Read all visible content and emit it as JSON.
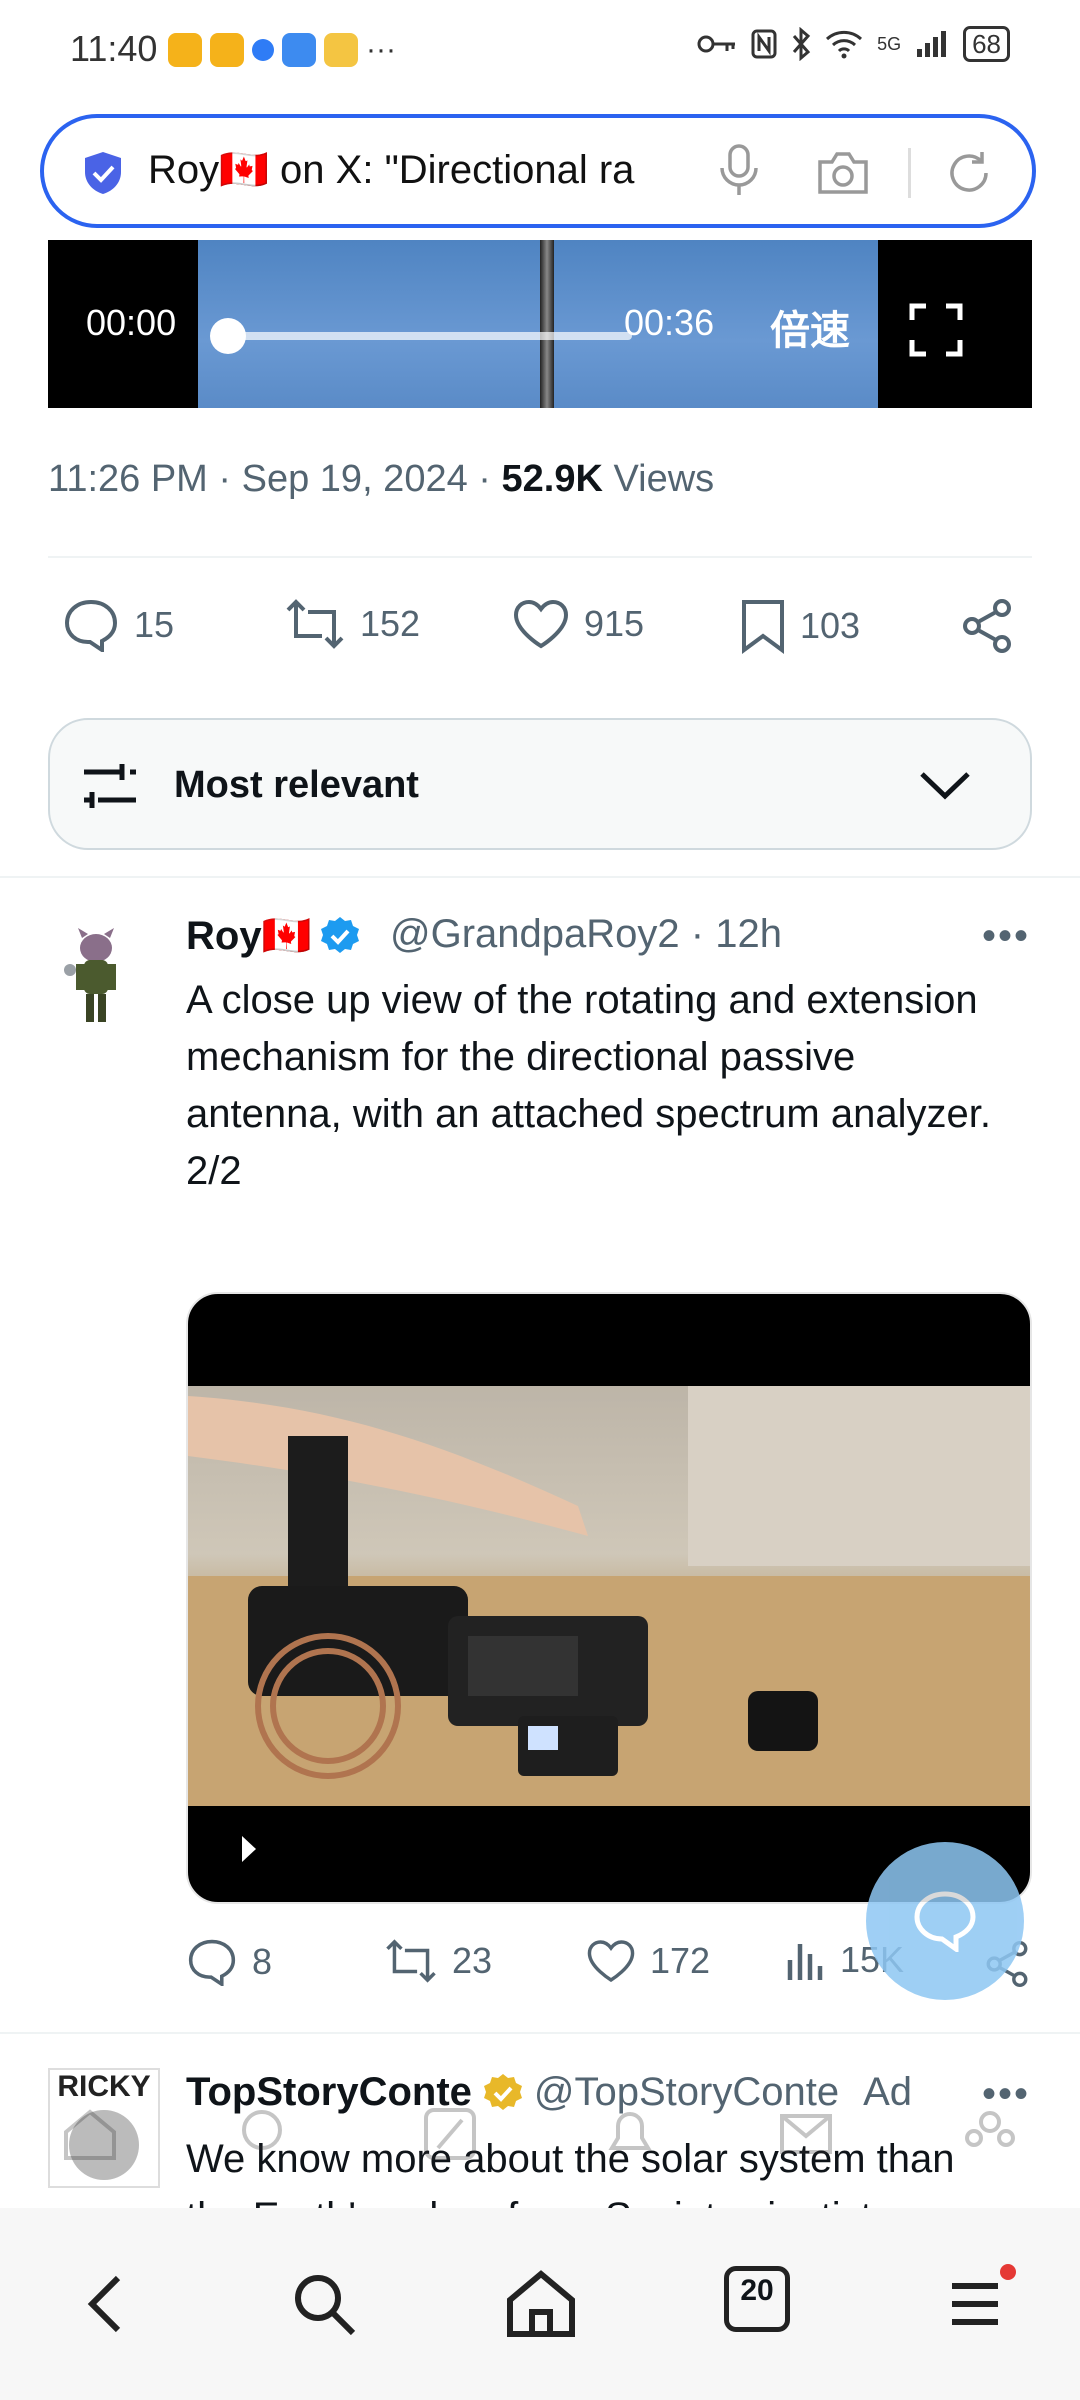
{
  "status_bar": {
    "time": "11:40",
    "battery": "68",
    "network": "5G"
  },
  "search_bar": {
    "title": "Roy🇨🇦 on X: \"Directional ra"
  },
  "video_player": {
    "current_time": "00:00",
    "duration": "00:36",
    "speed_label": "倍速",
    "progress": 0
  },
  "tweet_meta": {
    "time": "11:26 PM",
    "date": "Sep 19, 2024",
    "views_count": "52.9K",
    "views_label": "Views"
  },
  "main_actions": {
    "replies": "15",
    "reposts": "152",
    "likes": "915",
    "bookmarks": "103"
  },
  "filter": {
    "label": "Most relevant"
  },
  "reply": {
    "name": "Roy🇨🇦",
    "handle": "@GrandpaRoy2",
    "age": "12h",
    "text": "A close up view of the rotating and extension mechanism for the directional passive antenna, with an attached spectrum analyzer.",
    "thread_index": "2/2",
    "actions": {
      "replies": "8",
      "reposts": "23",
      "likes": "172",
      "views": "15K"
    }
  },
  "next_tweet": {
    "avatar_text": "RICKY",
    "name": "TopStoryConte",
    "handle": "@TopStoryConte",
    "ad_label": "Ad",
    "text_line1": "We know more about the solar system than",
    "text_line2": "the Earth's subsurface. Soviet scientists"
  },
  "bottom_nav": {
    "tabs_count": "20"
  },
  "colors": {
    "accent": "#1d9bf0",
    "search_border": "#2b63f0",
    "muted": "#536471"
  }
}
